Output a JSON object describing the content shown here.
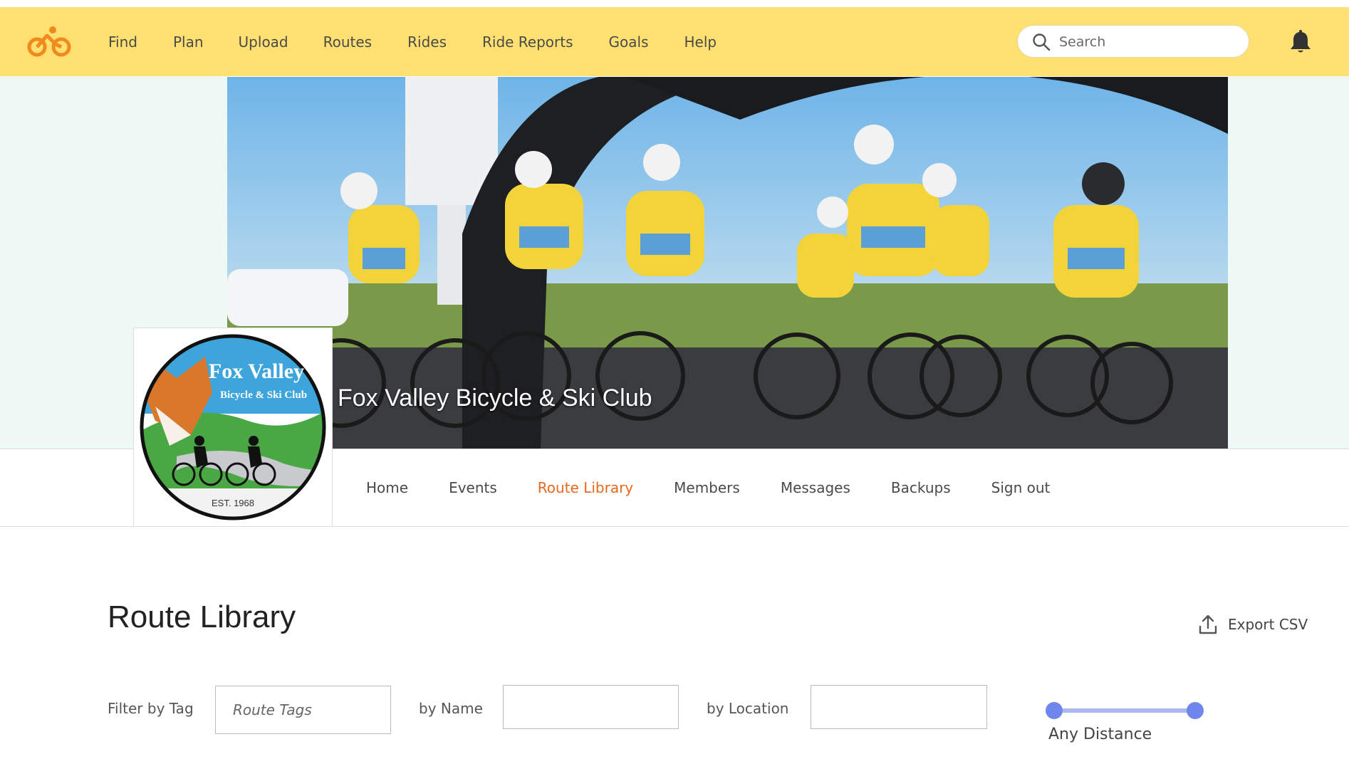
{
  "nav": {
    "items": [
      "Find",
      "Plan",
      "Upload",
      "Routes",
      "Rides",
      "Ride Reports",
      "Goals",
      "Help"
    ],
    "search_placeholder": "Search"
  },
  "club": {
    "name": "Fox Valley Bicycle & Ski Club",
    "logo_text": "Fox Valley",
    "logo_subtext": "Bicycle & Ski Club",
    "logo_est": "EST. 1968"
  },
  "tabs": {
    "items": [
      "Home",
      "Events",
      "Route Library",
      "Members",
      "Messages",
      "Backups",
      "Sign out"
    ],
    "active": "Route Library"
  },
  "page": {
    "title": "Route Library",
    "export_label": "Export CSV"
  },
  "filters": {
    "tag_label": "Filter by Tag",
    "tag_placeholder": "Route Tags",
    "name_label": "by Name",
    "name_value": "",
    "location_label": "by Location",
    "location_value": "",
    "distance_label": "Any Distance"
  },
  "colors": {
    "topbar": "#ffe070",
    "accent": "#e8681e",
    "slider": "#6f86ec"
  }
}
